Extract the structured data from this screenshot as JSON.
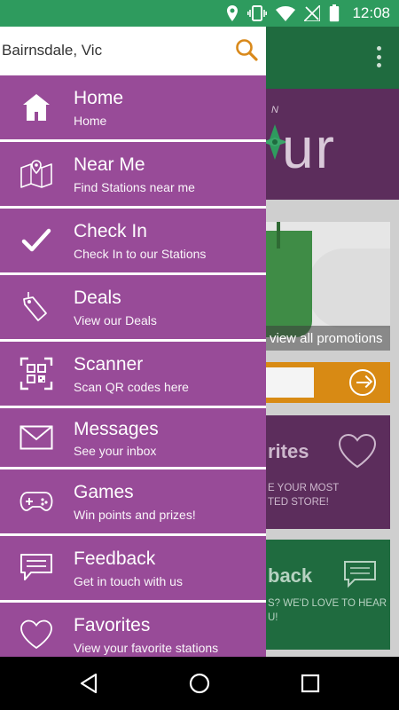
{
  "status_bar": {
    "time": "12:08",
    "icons": [
      "location-icon",
      "vibrate-icon",
      "wifi-icon",
      "no-signal-icon",
      "battery-icon"
    ]
  },
  "search": {
    "value": "Bairnsdale, Vic",
    "placeholder": "",
    "icon": "search-icon",
    "icon_color": "#d9891b"
  },
  "menu": {
    "items": [
      {
        "title": "Home",
        "subtitle": "Home",
        "icon": "home-icon"
      },
      {
        "title": "Near Me",
        "subtitle": "Find Stations near me",
        "icon": "map-icon"
      },
      {
        "title": "Check In",
        "subtitle": "Check In to our Stations",
        "icon": "checkmark-icon"
      },
      {
        "title": "Deals",
        "subtitle": "View our Deals",
        "icon": "tag-icon"
      },
      {
        "title": "Scanner",
        "subtitle": "Scan QR codes here",
        "icon": "qr-scanner-icon"
      },
      {
        "title": "Messages",
        "subtitle": "See your inbox",
        "icon": "envelope-icon"
      },
      {
        "title": "Games",
        "subtitle": "Win points and prizes!",
        "icon": "gamepad-icon"
      },
      {
        "title": "Feedback",
        "subtitle": "Get in touch with us",
        "icon": "chat-bubble-icon"
      },
      {
        "title": "Favorites",
        "subtitle": "View your favorite stations",
        "icon": "heart-icon"
      }
    ],
    "color": "#984b98"
  },
  "background": {
    "hero_text": "ur",
    "hero_small": "N",
    "promo_caption": "view all promotions",
    "favorites_title": "rites",
    "favorites_sub_1": "E YOUR MOST",
    "favorites_sub_2": "TED STORE!",
    "feedback_title": "back",
    "feedback_sub_1": "S? WE'D LOVE TO HEAR",
    "feedback_sub_2": "U!"
  },
  "colors": {
    "status_bar": "#2e9b5e",
    "toolbar": "#1f6b3f",
    "menu_item": "#984b98",
    "accent": "#d9891b"
  },
  "nav": {
    "buttons": [
      "back-icon",
      "home-circle-icon",
      "recents-icon"
    ]
  }
}
